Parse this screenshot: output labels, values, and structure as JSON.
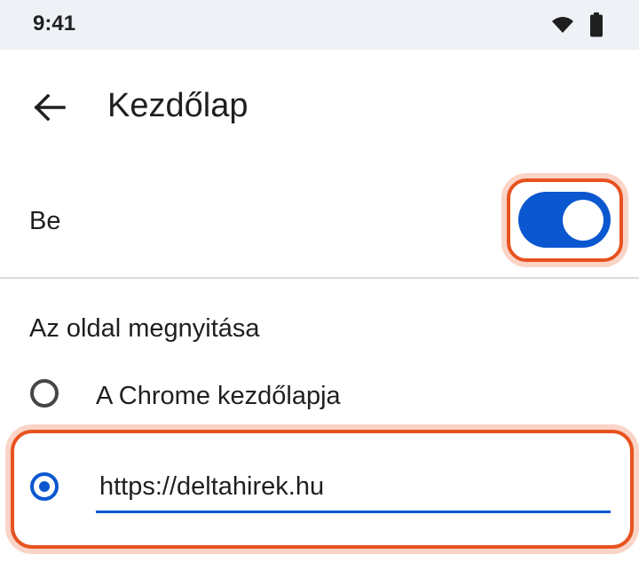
{
  "status_bar": {
    "time": "9:41",
    "icons": [
      "wifi-icon",
      "battery-icon"
    ]
  },
  "app_bar": {
    "back_icon": "arrow-left-icon",
    "title": "Kezdőlap"
  },
  "toggle": {
    "label": "Be",
    "state": "on"
  },
  "section": {
    "title": "Az oldal megnyitása"
  },
  "options": [
    {
      "label": "A Chrome kezdőlapja",
      "selected": false
    },
    {
      "value": "https://deltahirek.hu",
      "selected": true
    }
  ],
  "colors": {
    "accent": "#0b57d0",
    "highlight": "#e8521f",
    "status_bar_bg": "#eef1f6"
  }
}
